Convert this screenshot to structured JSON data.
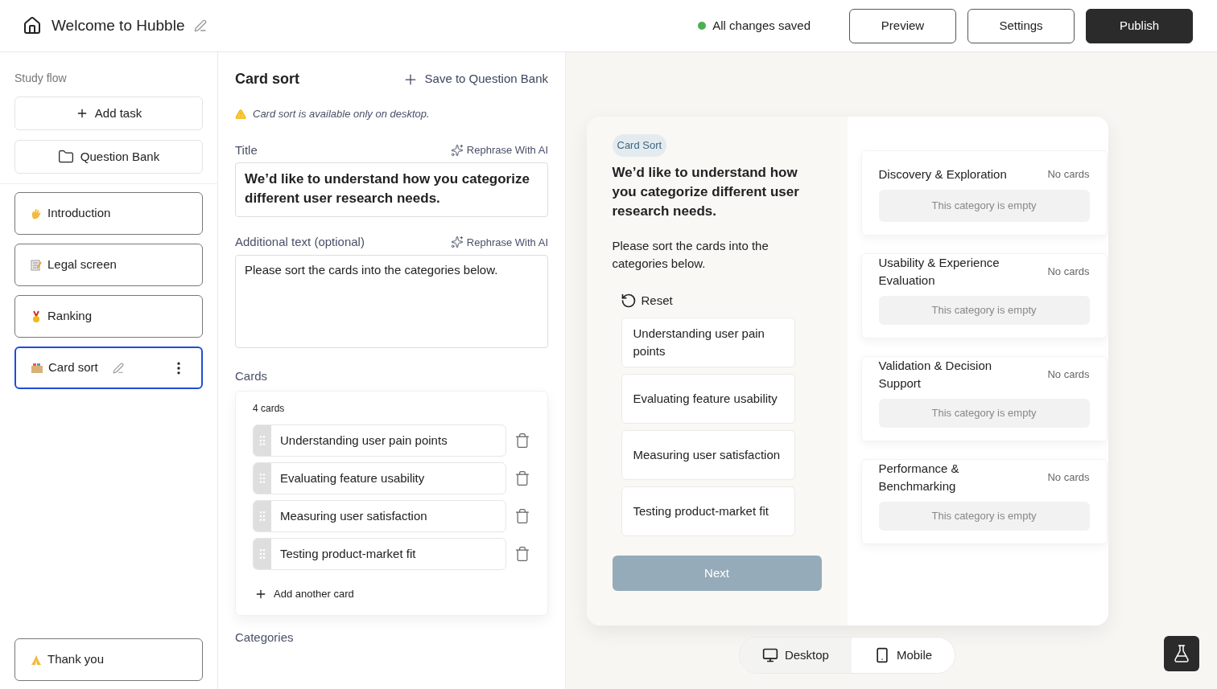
{
  "header": {
    "title": "Welcome to Hubble",
    "save_status": "All changes saved",
    "saved": true,
    "buttons": [
      {
        "label": "Preview",
        "kind": "outline"
      },
      {
        "label": "Settings",
        "kind": "outline"
      },
      {
        "label": "Publish",
        "kind": "primary"
      }
    ]
  },
  "sidebar": {
    "heading": "Study flow",
    "actions": [
      {
        "label": "Add task",
        "kind": "add"
      },
      {
        "label": "Question Bank",
        "kind": "folder"
      }
    ],
    "items": [
      {
        "label": "Introduction",
        "selected": false
      },
      {
        "label": "Legal screen",
        "selected": false
      },
      {
        "label": "Ranking",
        "selected": false
      },
      {
        "label": "Card sort",
        "selected": true
      }
    ],
    "final_item": {
      "label": "Thank you",
      "selected": false
    }
  },
  "editor": {
    "heading": "Card sort",
    "save_link": "Save to Question Bank",
    "warning": "Card sort is available only on desktop.",
    "fields": [
      {
        "label": "Title",
        "ai_link": "Rephrase With AI",
        "value": "We’d like to understand how you categorize different user research needs.",
        "kind": "title"
      },
      {
        "label": "Additional text (optional)",
        "ai_link": "Rephrase With AI",
        "value": "Please sort the cards into the categories below.",
        "kind": "body"
      }
    ],
    "cards_label": "Cards",
    "cards_count": "4 cards",
    "cards": [
      "Understanding user pain points",
      "Evaluating feature usability",
      "Measuring user satisfaction",
      "Testing product-market fit"
    ],
    "add_card": "Add another card",
    "categories_label": "Categories"
  },
  "preview": {
    "badge": "Card Sort",
    "title": "We’d like to understand how you categorize different user research needs.",
    "text": "Please sort the cards into the categories below.",
    "reset": "Reset",
    "cards": [
      "Understanding user pain points",
      "Evaluating feature usability",
      "Measuring user satisfaction",
      "Testing product-market fit"
    ],
    "next": "Next",
    "next_disabled": true,
    "categories": [
      {
        "name": "Discovery & Exploration",
        "count": "No cards",
        "empty": "This category is empty"
      },
      {
        "name": "Usability & Experience Evaluation",
        "count": "No cards",
        "empty": "This category is empty"
      },
      {
        "name": "Validation & Decision Support",
        "count": "No cards",
        "empty": "This category is empty"
      },
      {
        "name": "Performance & Benchmarking",
        "count": "No cards",
        "empty": "This category is empty"
      }
    ],
    "devices": [
      {
        "label": "Desktop",
        "kind": "desktop",
        "selected": true
      },
      {
        "label": "Mobile",
        "kind": "mobile",
        "selected": false
      }
    ]
  }
}
